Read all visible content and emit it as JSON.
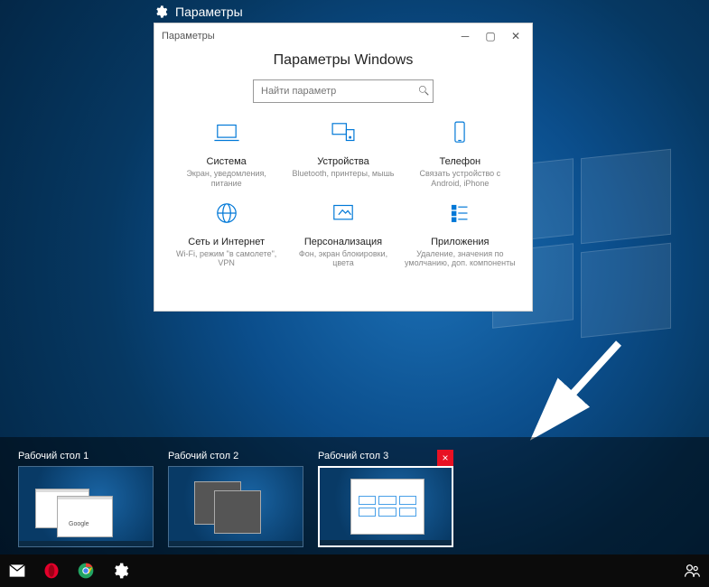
{
  "window": {
    "task_view_label": "Параметры",
    "titlebar_text": "Параметры",
    "heading": "Параметры Windows",
    "search_placeholder": "Найти параметр"
  },
  "tiles": [
    {
      "label": "Система",
      "sub": "Экран, уведомления, питание"
    },
    {
      "label": "Устройства",
      "sub": "Bluetooth, принтеры, мышь"
    },
    {
      "label": "Телефон",
      "sub": "Связать устройство с Android, iPhone"
    },
    {
      "label": "Сеть и Интернет",
      "sub": "Wi-Fi, режим \"в самолете\", VPN"
    },
    {
      "label": "Персонализация",
      "sub": "Фон, экран блокировки, цвета"
    },
    {
      "label": "Приложения",
      "sub": "Удаление, значения по умолчанию, доп. компоненты"
    }
  ],
  "desktops": [
    {
      "label": "Рабочий стол 1",
      "active": false
    },
    {
      "label": "Рабочий стол 2",
      "active": false
    },
    {
      "label": "Рабочий стол 3",
      "active": true
    }
  ],
  "close_button": "×",
  "taskbar": {
    "items": [
      "mail-icon",
      "opera-icon",
      "chrome-icon",
      "settings-icon"
    ],
    "right": [
      "people-icon"
    ]
  },
  "colors": {
    "accent": "#0078d7",
    "close": "#e81123"
  }
}
